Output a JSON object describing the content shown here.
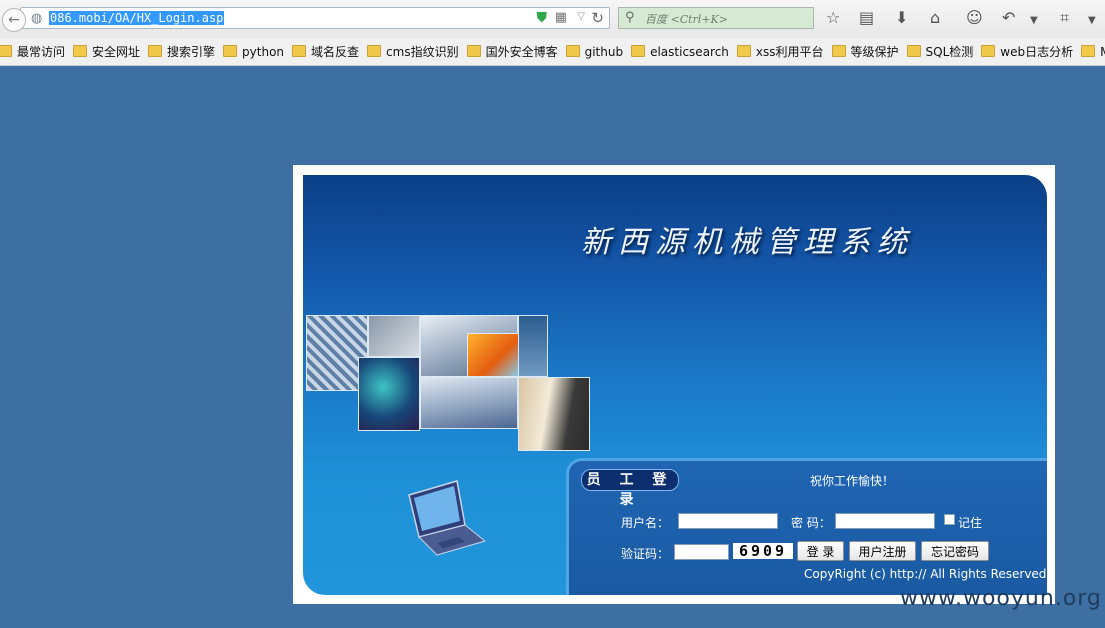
{
  "browser": {
    "url": "086.mobi/OA/HX_Login.asp",
    "search_placeholder": "百度 <Ctrl+K>"
  },
  "bookmarks": [
    "最常访问",
    "安全网址",
    "搜索引擎",
    "python",
    "域名反查",
    "cms指纹识别",
    "国外安全博客",
    "github",
    "elasticsearch",
    "xss利用平台",
    "等级保护",
    "SQL检测",
    "web日志分析",
    "MD"
  ],
  "login": {
    "system_title": "新西源机械管理系统",
    "section_label": "员 工 登 录",
    "greeting": "祝你工作愉快！",
    "username_label": "用户名：",
    "password_label": "密 码：",
    "remember_label": "记住",
    "captcha_label": "验证码：",
    "captcha_value": "6909",
    "login_button": "登 录",
    "register_button": "用户注册",
    "forgot_button": "忘记密码",
    "copyright": "CopyRight (c) http:// All Rights Reserved"
  },
  "watermark": "www.wooyun.org",
  "colors": {
    "page_background": "#3d6fa3",
    "url_highlight": "#3399ff",
    "panel_dark": "#0a3f86",
    "panel_light": "#2196da"
  },
  "icons": [
    "back-arrow-icon",
    "globe-icon",
    "shield-icon",
    "qr-code-icon",
    "reload-icon",
    "search-icon",
    "star-icon",
    "reading-list-icon",
    "download-icon",
    "home-icon",
    "emoji-icon",
    "undo-icon",
    "crop-icon",
    "menu-icon",
    "folder-icon",
    "laptop-icon"
  ]
}
